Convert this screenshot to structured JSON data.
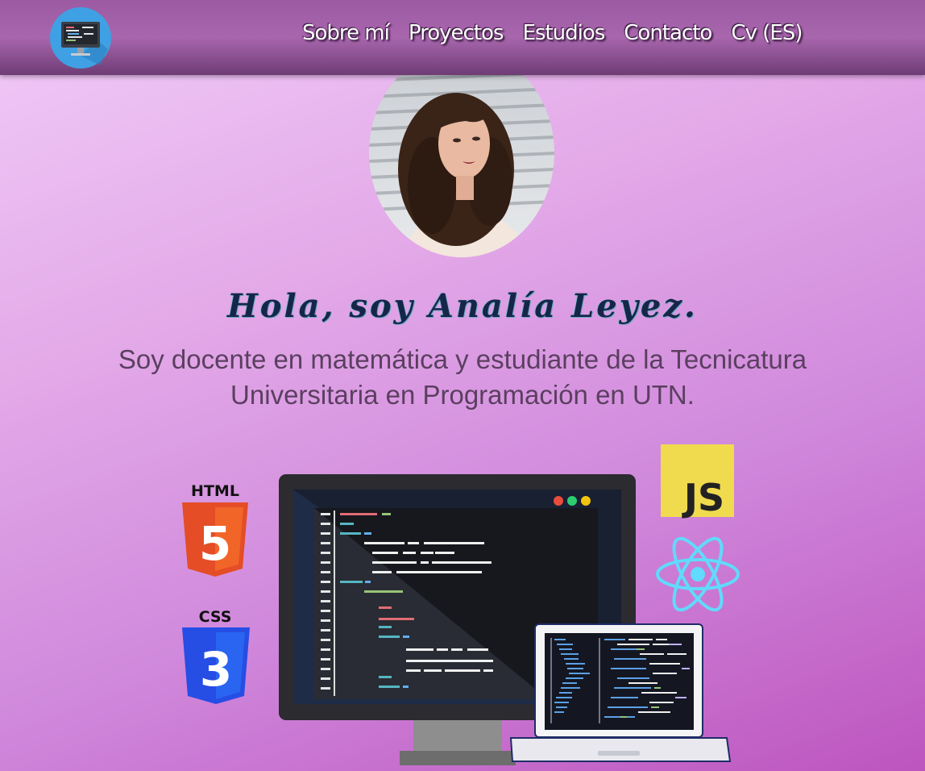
{
  "nav": {
    "logo_icon": "desktop-computer-code-icon",
    "links": [
      {
        "label": "Sobre mí"
      },
      {
        "label": "Proyectos"
      },
      {
        "label": "Estudios"
      },
      {
        "label": "Contacto"
      },
      {
        "label": "Cv (ES)"
      }
    ]
  },
  "hero": {
    "title": "Hola, soy Analía Leyez.",
    "subtitle": "Soy docente en matemática y estudiante de la Tecnicatura Universitaria en Programación en UTN."
  },
  "tech_icons": {
    "html_label": "HTML",
    "html_number": "5",
    "css_label": "CSS",
    "css_number": "3",
    "js_label": "JS",
    "react_icon": "react-atom-icon"
  },
  "colors": {
    "html_orange": "#e44d26",
    "css_blue": "#264de4",
    "js_yellow": "#f0db4f",
    "react_blue": "#61dafb"
  }
}
